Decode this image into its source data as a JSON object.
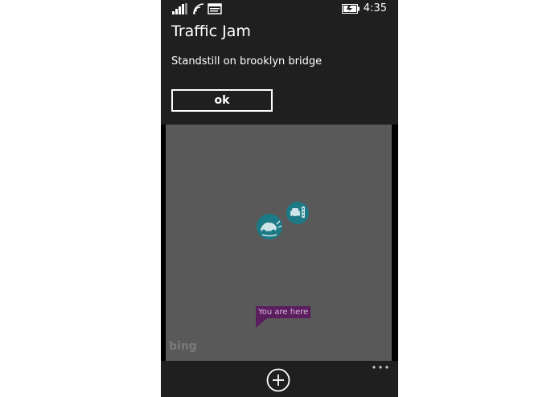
{
  "status_bar": {
    "time": "4:35",
    "icons": [
      "signal-icon",
      "wifi-icon",
      "message-icon",
      "battery-icon"
    ]
  },
  "dialog": {
    "title": "Traffic Jam",
    "message": "Standstill on brooklyn bridge",
    "ok_label": "ok"
  },
  "map": {
    "you_are_here_label": "You are here",
    "provider_logo": "bing",
    "pois": [
      "accident-icon",
      "traffic-car-icon"
    ]
  },
  "app_bar": {
    "buttons": [
      "add-icon",
      "more-icon"
    ]
  },
  "colors": {
    "chrome": "#1f1f1f",
    "map_background": "#595959",
    "poi_teal": "#1c7a86",
    "pin_purple": "#5a1e5e"
  }
}
